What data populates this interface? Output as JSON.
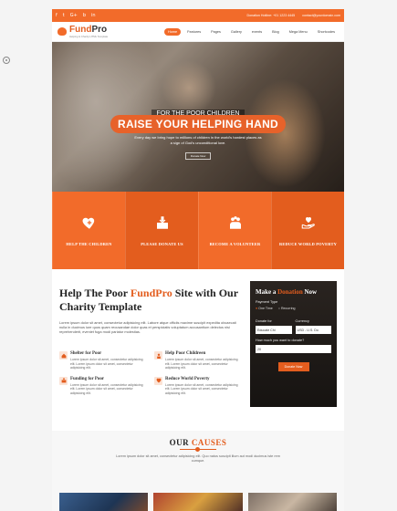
{
  "topbar": {
    "social": [
      "f",
      "t",
      "G+",
      "b",
      "in"
    ],
    "hotline": "Donation Hotline: +01 1223 4445",
    "email": "contact@yourdomain.com"
  },
  "nav": {
    "logo_main": "Fund",
    "logo_accent": "Pro",
    "logo_tag": "Helping & Charity HTML Template",
    "items": [
      "Home",
      "Features",
      "Pages",
      "Gallery",
      "events",
      "Blog",
      "Mega Menu",
      "Shortcodes"
    ]
  },
  "hero": {
    "subtitle": "FOR THE POOR CHILDREN",
    "title": "RAISE YOUR HELPING HAND",
    "desc": "Every day we bring hope to millions of children in the world's hardest places as a sign of God's unconditional love.",
    "button": "Donate Now"
  },
  "features": [
    {
      "label": "HELP THE CHILDREN",
      "icon": "heart-hand-icon"
    },
    {
      "label": "PLEASE DONATE US",
      "icon": "donate-box-icon"
    },
    {
      "label": "BECOME A VOLUNTEER",
      "icon": "volunteer-icon"
    },
    {
      "label": "REDUCE WORLD POVERTY",
      "icon": "care-hand-icon"
    }
  ],
  "help": {
    "title_pre": "Help The Poor ",
    "title_brand": "FundPro",
    "title_post": " Site with Our Charity Template",
    "intro": "Lorem ipsum dolor sit amet, consectetur adipisicing elit. Labore atque officiis maxime suscipit expedita obcaecati nulla in ducimus iure quos quam recusandae dolor quas et perspiciatis voluptatum accusantium delectus nisi reprehenderit, eveniet fuga modi pariatur molestias.",
    "items": [
      {
        "title": "Shelter for Poor",
        "body": "Lorem ipsum dolor sit amet, consectetur adipisicing elit. Lorem ipsum dolor sit amet, consectetur adipisicing elit."
      },
      {
        "title": "Help Poor Childreen",
        "body": "Lorem ipsum dolor sit amet, consectetur adipisicing elit. Lorem ipsum dolor sit amet, consectetur adipisicing elit."
      },
      {
        "title": "Funding for Poor",
        "body": "Lorem ipsum dolor sit amet, consectetur adipisicing elit. Lorem ipsum dolor sit amet, consectetur adipisicing elit."
      },
      {
        "title": "Reduce World Poverty",
        "body": "Lorem ipsum dolor sit amet, consectetur adipisicing elit. Lorem ipsum dolor sit amet, consectetur adipisicing elit."
      }
    ]
  },
  "donate": {
    "title_pre": "Make a ",
    "title_hl": "Donation",
    "title_post": " Now",
    "payment_label": "Payment Type",
    "radio_one": "One Time",
    "radio_recurring": "Recurring",
    "donate_for_label": "Donate for",
    "currency_label": "Currency",
    "donate_for_value": "Educate Chi",
    "currency_value": "USD - U.S. Do",
    "amount_label": "How much you want to donate?",
    "amount_value": "20",
    "button": "Donate Now"
  },
  "causes": {
    "title_pre": "OUR ",
    "title_brand": "CAUSES",
    "desc": "Lorem ipsum dolor sit amet, consectetur adipisicing elit. Quo natus suscipit illum aut modi ducimus iste rem cumque."
  },
  "colors": {
    "accent": "#f26b2a",
    "accent_dark": "#e35d1e"
  }
}
